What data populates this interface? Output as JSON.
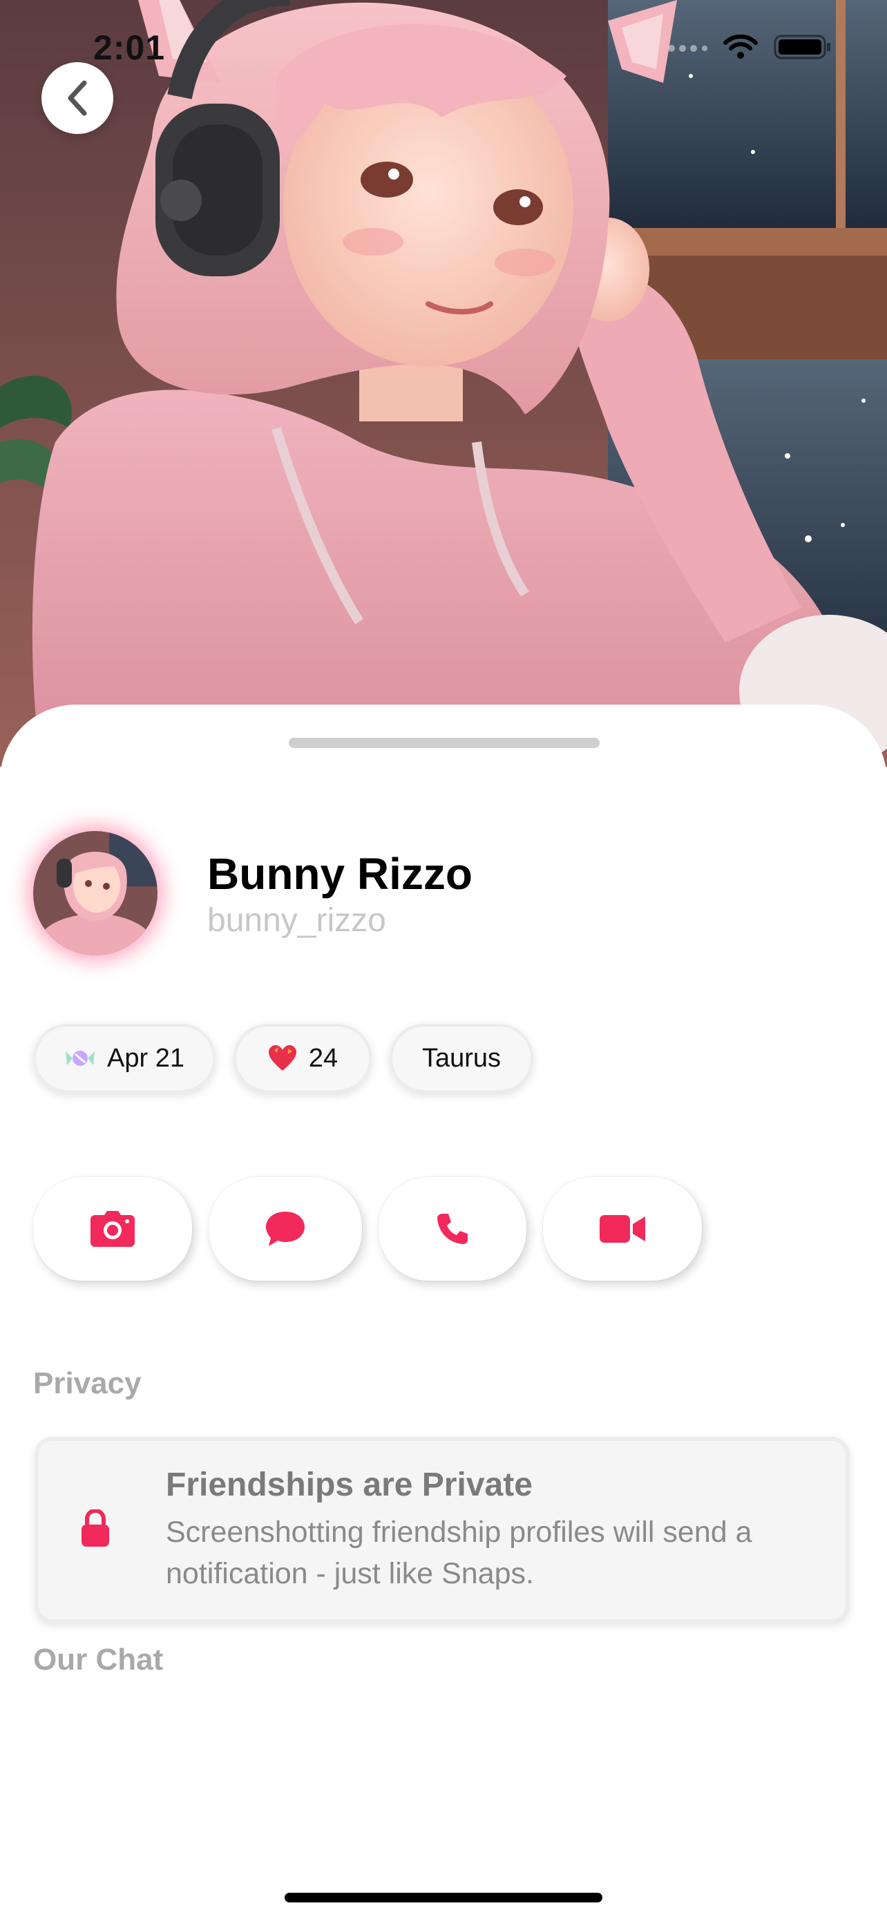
{
  "status_bar": {
    "time": "2:01"
  },
  "profile": {
    "display_name": "Bunny Rizzo",
    "username": "bunny_rizzo"
  },
  "badges": [
    {
      "icon": "candy-icon",
      "label": "Apr 21"
    },
    {
      "icon": "heart-icon",
      "label": "24"
    },
    {
      "icon": "",
      "label": "Taurus"
    }
  ],
  "actions": [
    {
      "icon": "camera-icon"
    },
    {
      "icon": "chat-icon"
    },
    {
      "icon": "phone-icon"
    },
    {
      "icon": "video-icon"
    }
  ],
  "sections": {
    "privacy_label": "Privacy",
    "chat_label": "Our Chat"
  },
  "privacy_card": {
    "title": "Friendships are Private",
    "description": "Screenshotting friendship profiles will send a notification - just like Snaps."
  },
  "colors": {
    "accent": "#f2295b",
    "muted_text": "#a9a9a9"
  }
}
